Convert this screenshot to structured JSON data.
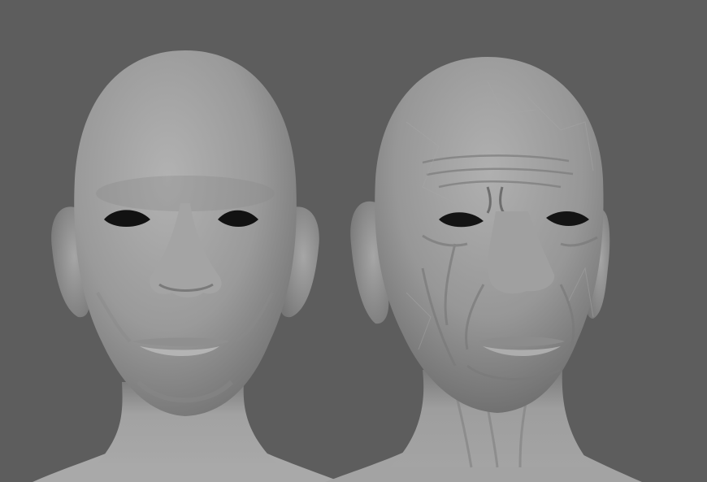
{
  "scene": {
    "background_color": "#5d5d5d",
    "models": [
      {
        "name": "smooth-base-head",
        "material_color": "#9c9c9c",
        "surface": "smooth"
      },
      {
        "name": "sculpted-aged-head",
        "material_color": "#9a9a9a",
        "surface": "faceted-wrinkled"
      }
    ]
  }
}
